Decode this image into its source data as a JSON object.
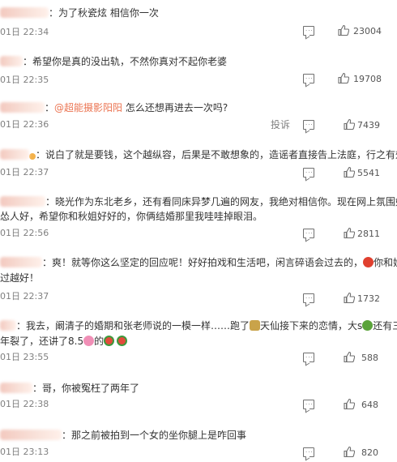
{
  "comments": [
    {
      "text": "：为了秋瓷炫 相信你一次",
      "date": "01日 22:34",
      "likes": "23004"
    },
    {
      "text": "：希望你是真的没出轨，不然你真对不起你老婆",
      "date": "01日 22:35",
      "likes": "19708"
    },
    {
      "mention": "@超能摄影阳阳",
      "text": " 怎么还想再进去一次吗?",
      "date": "01日 22:36",
      "report": "投诉",
      "likes": "7439"
    },
    {
      "text": "：说白了就是要钱，这个越纵容，后果是不敢想象的，造谣者直接告上法庭，行之有效",
      "date": "01日 22:37",
      "likes": "5541"
    },
    {
      "line1": "：晓光作为东北老乡，还有看同床异梦几遍的网友，我绝对相信你。现在网上氛围好奇",
      "line2": "怂人好，希望你和秋姐好好的，你俩结婚那里我哇哇掉眼泪。",
      "date": "01日 22:56",
      "likes": "2811"
    },
    {
      "line1": "：爽！就等你这么坚定的回应呢！好好拍戏和生活吧，闲言碎语会过去的，",
      "line1b": "你和姐",
      "line2": "过越好！",
      "date": "01日 22:37",
      "likes": "1732"
    },
    {
      "line1": "：我去，阚清子的婚期和张老师说的一模一样……跑了",
      "line1b": "天仙接下来的恋情，大s",
      "line1c": "还有三",
      "line2": "年裂了，还讲了8.5",
      "line2b": "的",
      "date": "01日 23:55",
      "likes": "588"
    },
    {
      "text": "：哥，你被冤枉了两年了",
      "date": "01日 22:38",
      "likes": "648"
    },
    {
      "text": "：那之前被拍到一个女的坐你腿上是咋回事",
      "date": "01日 23:13",
      "likes": "820"
    }
  ],
  "icons": {
    "reply": "comment-icon",
    "like": "thumbs-up-icon"
  }
}
